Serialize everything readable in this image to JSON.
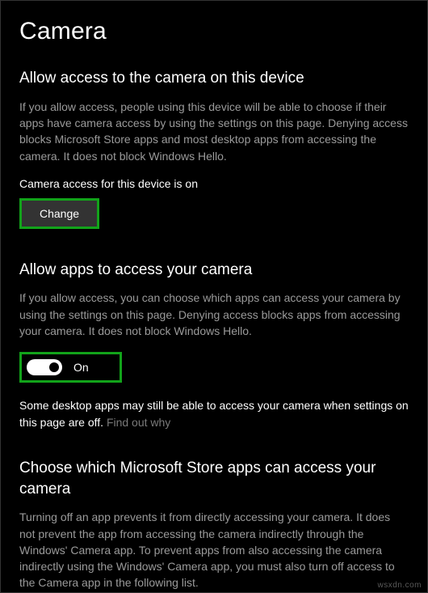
{
  "page": {
    "title": "Camera"
  },
  "section1": {
    "heading": "Allow access to the camera on this device",
    "body": "If you allow access, people using this device will be able to choose if their apps have camera access by using the settings on this page. Denying access blocks Microsoft Store apps and most desktop apps from accessing the camera. It does not block Windows Hello.",
    "status": "Camera access for this device is on",
    "change_label": "Change"
  },
  "section2": {
    "heading": "Allow apps to access your camera",
    "body": "If you allow access, you can choose which apps can access your camera by using the settings on this page. Denying access blocks apps from accessing your camera. It does not block Windows Hello.",
    "toggle_state": "On",
    "note_text": "Some desktop apps may still be able to access your camera when settings on this page are off. ",
    "note_link": "Find out why"
  },
  "section3": {
    "heading": "Choose which Microsoft Store apps can access your camera",
    "body": "Turning off an app prevents it from directly accessing your camera. It does not prevent the app from accessing the camera indirectly through the Windows' Camera app. To prevent apps from also accessing the camera indirectly using the Windows' Camera app, you must also turn off access to the Camera app in the following list."
  },
  "watermark": "wsxdn.com"
}
